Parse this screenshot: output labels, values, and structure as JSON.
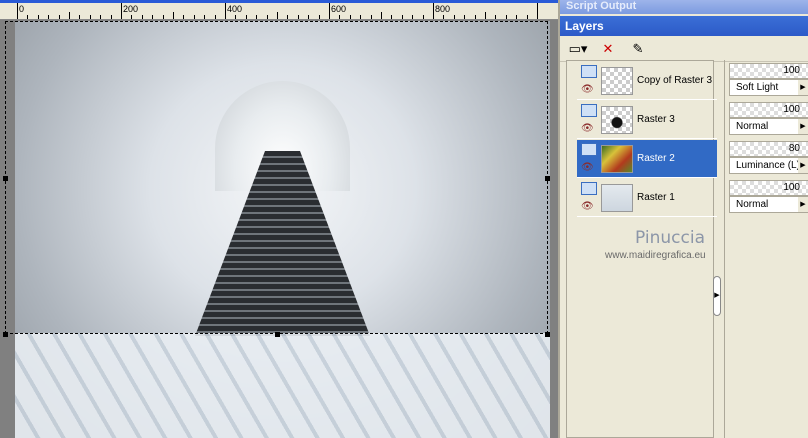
{
  "ruler": {
    "labels": [
      "0",
      "200",
      "400",
      "600",
      "800"
    ]
  },
  "panels": {
    "script_output": "Script Output",
    "layers_title": "Layers"
  },
  "toolbar": [
    {
      "icon": "new-layer-icon",
      "glyph": "▭▾"
    },
    {
      "icon": "delete-layer-icon",
      "glyph": "✕"
    },
    {
      "icon": "edit-selection-icon",
      "glyph": "✎"
    }
  ],
  "layers": [
    {
      "name": "Copy of Raster 3",
      "opacity": "100",
      "blend": "Soft Light",
      "selected": false
    },
    {
      "name": "Raster 3",
      "opacity": "100",
      "blend": "Normal",
      "selected": false
    },
    {
      "name": "Raster 2",
      "opacity": "80",
      "blend": "Luminance (L)",
      "selected": true
    },
    {
      "name": "Raster 1",
      "opacity": "100",
      "blend": "Normal",
      "selected": false
    }
  ],
  "watermark": {
    "name": "Pinuccia",
    "site": "www.maidiregrafica.eu"
  },
  "colors": {
    "title_bar": "#2c5ac8",
    "selection": "#316ac5"
  }
}
